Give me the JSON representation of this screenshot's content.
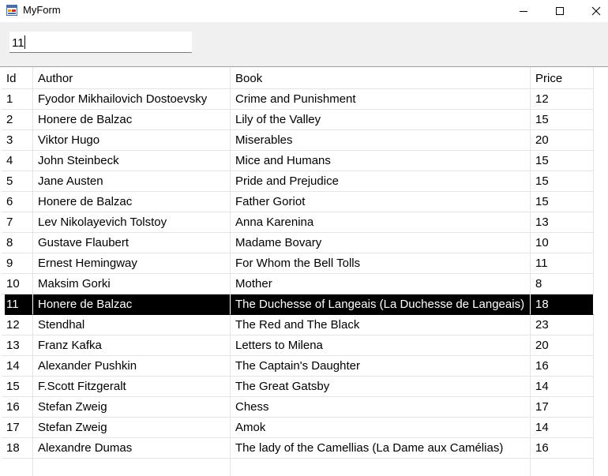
{
  "window": {
    "title": "MyForm",
    "icon": "winforms-app-icon",
    "controls": [
      "minimize-icon",
      "maximize-icon",
      "close-icon"
    ]
  },
  "search": {
    "value": "11"
  },
  "table": {
    "columns": [
      "Id",
      "Author",
      "Book",
      "Price"
    ],
    "selected_row_index": 10,
    "rows": [
      [
        "1",
        "Fyodor Mikhailovich Dostoevsky",
        "Crime and Punishment",
        "12"
      ],
      [
        "2",
        "Honere de Balzac",
        "Lily of the Valley",
        "15"
      ],
      [
        "3",
        "Viktor Hugo",
        "Miserables",
        "20"
      ],
      [
        "4",
        "John Steinbeck",
        "Mice and Humans",
        "15"
      ],
      [
        "5",
        "Jane Austen",
        "Pride and Prejudice",
        "15"
      ],
      [
        "6",
        "Honere de Balzac",
        "Father Goriot",
        "15"
      ],
      [
        "7",
        "Lev Nikolayevich Tolstoy",
        "Anna Karenina",
        "13"
      ],
      [
        "8",
        "Gustave Flaubert",
        "Madame Bovary",
        "10"
      ],
      [
        "9",
        "Ernest Hemingway",
        "For Whom the Bell Tolls",
        "11"
      ],
      [
        "10",
        "Maksim Gorki",
        "Mother",
        "8"
      ],
      [
        "11",
        "Honere de Balzac",
        "The Duchesse of Langeais (La Duchesse de Langeais)",
        "18"
      ],
      [
        "12",
        "Stendhal",
        "The Red and The Black",
        "23"
      ],
      [
        "13",
        "Franz Kafka",
        "Letters to Milena",
        "20"
      ],
      [
        "14",
        "Alexander Pushkin",
        "The Captain's Daughter",
        "16"
      ],
      [
        "15",
        "F.Scott Fitzgeralt",
        "The Great Gatsby",
        "14"
      ],
      [
        "16",
        "Stefan Zweig",
        "Chess",
        "17"
      ],
      [
        "17",
        "Stefan Zweig",
        "Amok",
        "14"
      ],
      [
        "18",
        "Alexandre Dumas",
        "The lady of the Camellias (La Dame aux Camélias)",
        "16"
      ]
    ]
  },
  "colors": {
    "selection_background": "#000000",
    "selection_text": "#ffffff",
    "form_background": "#f0f0f0"
  }
}
